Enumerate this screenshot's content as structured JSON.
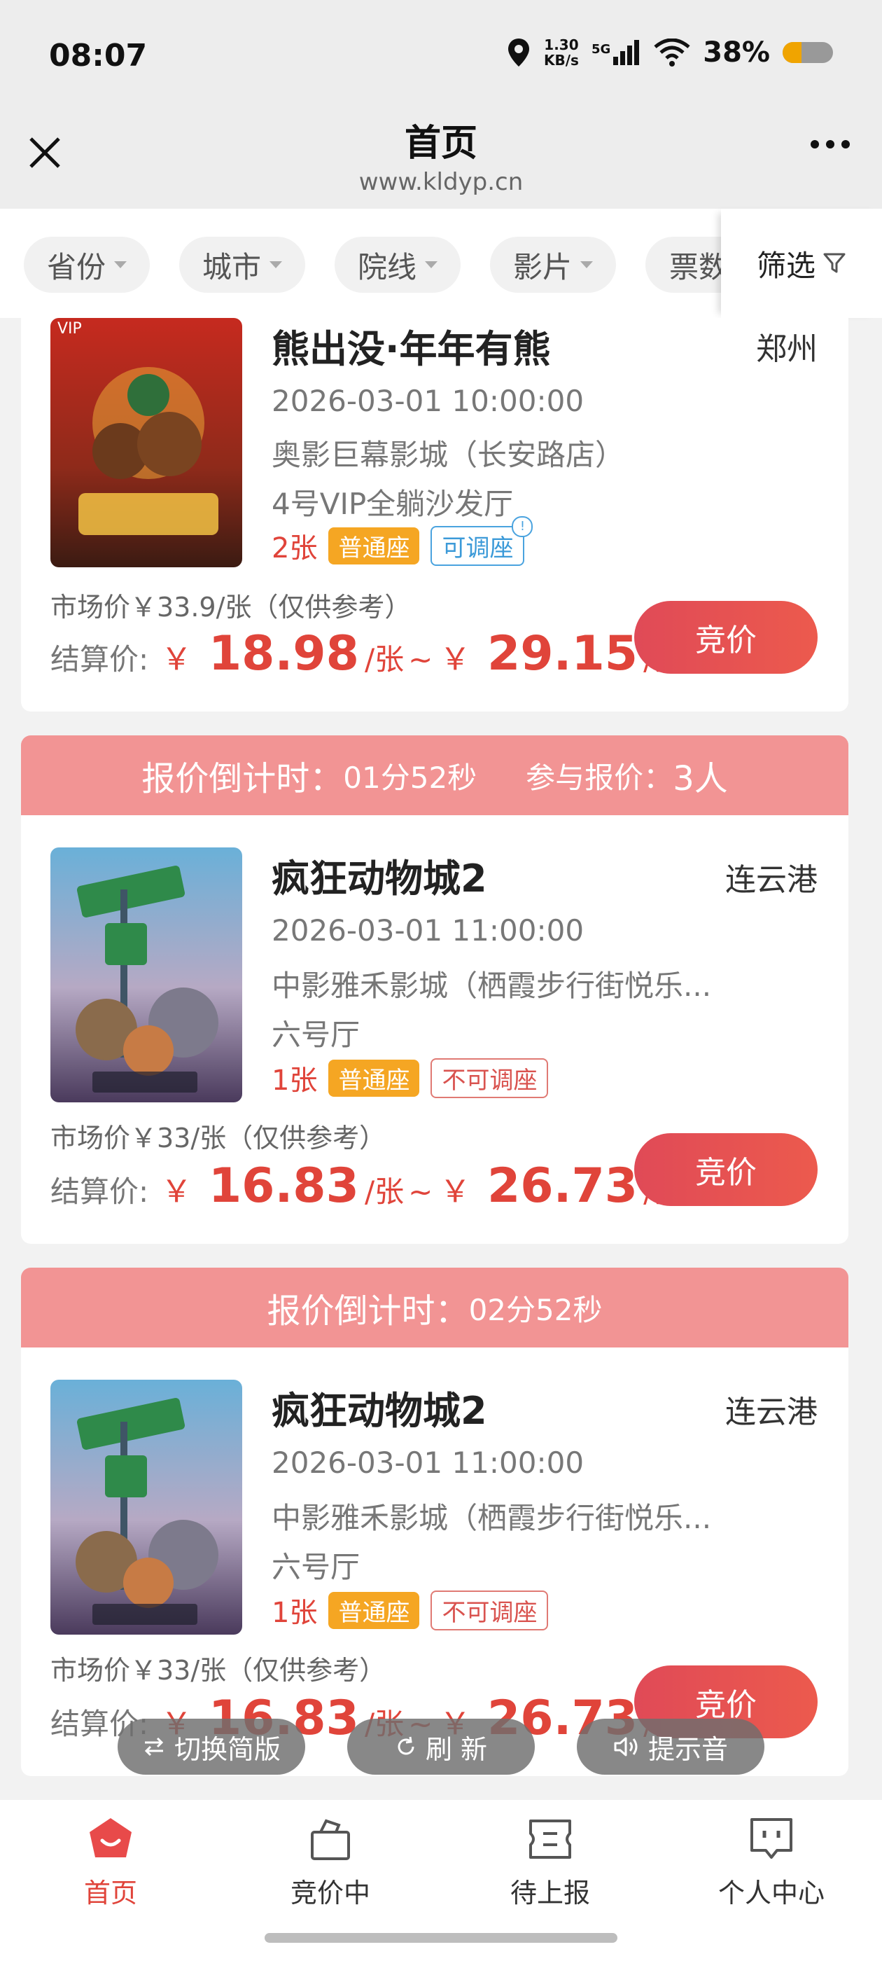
{
  "status_bar": {
    "time": "08:07",
    "net_speed_value": "1.30",
    "net_speed_unit": "KB/s",
    "network_type": "5G",
    "battery_percent": "38%",
    "battery_level": 0.38
  },
  "header": {
    "title": "首页",
    "url": "www.kldyp.cn"
  },
  "filters": {
    "chips": [
      "省份",
      "城市",
      "院线",
      "影片",
      "票数"
    ],
    "screen_label": "筛选"
  },
  "cards": [
    {
      "countdown_label": "",
      "countdown_value": "",
      "participants_label": "",
      "participants_value": "",
      "vip_badge": "VIP",
      "title": "熊出没·年年有熊",
      "city": "郑州",
      "datetime": "2026-03-01 10:00:00",
      "cinema": "奥影巨幕影城（长安路店）",
      "hall": "4号VIP全躺沙发厅",
      "count": "2张",
      "seat_type": "普通座",
      "adjustable": "可调座",
      "market_price": "市场价￥33.9/张（仅供参考）",
      "settle_label": "结算价:",
      "currency": "￥",
      "price_low": "18.98",
      "price_high": "29.15",
      "per_unit": "/张",
      "tilde": "~",
      "bid_label": "竞价"
    },
    {
      "countdown_label": "报价倒计时：",
      "countdown_value": "01分52秒",
      "participants_label": "参与报价：",
      "participants_value": "3人",
      "title": "疯狂动物城2",
      "city": "连云港",
      "datetime": "2026-03-01 11:00:00",
      "cinema": "中影雅禾影城（栖霞步行街悦乐...",
      "hall": "六号厅",
      "count": "1张",
      "seat_type": "普通座",
      "adjustable": "不可调座",
      "market_price": "市场价￥33/张（仅供参考）",
      "settle_label": "结算价:",
      "currency": "￥",
      "price_low": "16.83",
      "price_high": "26.73",
      "per_unit": "/张",
      "tilde": "~",
      "bid_label": "竞价"
    },
    {
      "countdown_label": "报价倒计时：",
      "countdown_value": "02分52秒",
      "title": "疯狂动物城2",
      "city": "连云港",
      "datetime": "2026-03-01 11:00:00",
      "cinema": "中影雅禾影城（栖霞步行街悦乐...",
      "hall": "六号厅",
      "count": "1张",
      "seat_type": "普通座",
      "adjustable": "不可调座",
      "market_price": "市场价￥33/张（仅供参考）",
      "settle_label": "结算价:",
      "currency": "￥",
      "price_low": "16.83",
      "price_high": "26.73",
      "per_unit": "/张",
      "tilde": "~",
      "bid_label": "竞价"
    }
  ],
  "float_buttons": {
    "switch_label": "切换简版",
    "refresh_label": "刷 新",
    "sound_label": "提示音"
  },
  "tabs": [
    {
      "label": "首页",
      "icon": "home-icon",
      "active": true
    },
    {
      "label": "竞价中",
      "icon": "bag-icon",
      "active": false
    },
    {
      "label": "待上报",
      "icon": "ticket-icon",
      "active": false
    },
    {
      "label": "个人中心",
      "icon": "chat-icon",
      "active": false
    }
  ],
  "colors": {
    "accent_red": "#e0443a",
    "header_pink": "#f29494",
    "tag_orange": "#f5a623",
    "tag_blue": "#4aa3df"
  }
}
